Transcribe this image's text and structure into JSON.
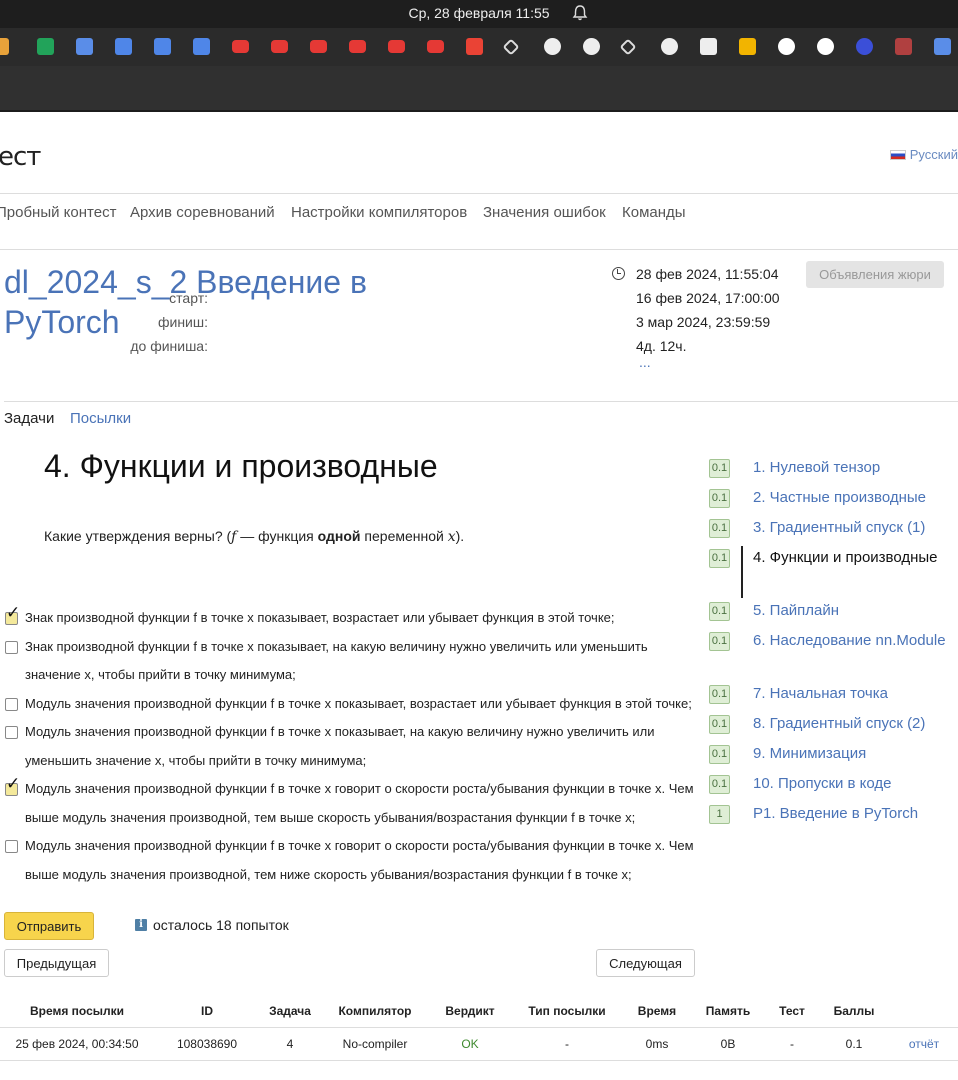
{
  "system": {
    "clock": "Ср, 28 февраля  11:55"
  },
  "bookmarks": [
    {
      "icon": "infinity-icon",
      "color": "#e8a23a"
    },
    {
      "icon": "sheets-icon",
      "color": "#22a35a"
    },
    {
      "icon": "swoosh-icon",
      "color": "#5a8de8"
    },
    {
      "icon": "cube-icon",
      "color": "#4f86e8"
    },
    {
      "icon": "cube-icon",
      "color": "#4f86e8"
    },
    {
      "icon": "cube-icon",
      "color": "#4f86e8"
    },
    {
      "icon": "youtube-icon",
      "color": "#e53935"
    },
    {
      "icon": "youtube-icon",
      "color": "#e53935"
    },
    {
      "icon": "youtube-icon",
      "color": "#e53935"
    },
    {
      "icon": "youtube-icon",
      "color": "#e53935"
    },
    {
      "icon": "youtube-icon",
      "color": "#e53935"
    },
    {
      "icon": "youtube-icon",
      "color": "#e53935"
    },
    {
      "icon": "gmail-icon",
      "color": "#ea4335"
    },
    {
      "icon": "link-icon",
      "color": "#dddddd"
    },
    {
      "icon": "github-icon",
      "color": "#eeeeee"
    },
    {
      "icon": "github-icon",
      "color": "#eeeeee"
    },
    {
      "icon": "link-icon",
      "color": "#dddddd"
    },
    {
      "icon": "github-icon",
      "color": "#eeeeee"
    },
    {
      "icon": "speedometer-icon",
      "color": "#eeeeee"
    },
    {
      "icon": "mail-icon",
      "color": "#f2b400"
    },
    {
      "icon": "google-icon",
      "color": "#ffffff"
    },
    {
      "icon": "google-icon",
      "color": "#ffffff"
    },
    {
      "icon": "zoom-icon",
      "color": "#3b4fd8"
    },
    {
      "icon": "kremlin-icon",
      "color": "#b04040"
    },
    {
      "icon": "spiral-icon",
      "color": "#5a8de8"
    }
  ],
  "site": {
    "logo": "ест",
    "language": "Русский"
  },
  "nav": [
    "Пробный контест",
    "Архив соревнований",
    "Настройки компиляторов",
    "Значения ошибок",
    "Команды"
  ],
  "contest": {
    "title": "dl_2024_s_2 Введение в PyTorch",
    "now": "28 фев 2024, 11:55:04",
    "start_label": "старт:",
    "start": "16 фев 2024, 17:00:00",
    "finish_label": "финиш:",
    "finish": "3 мар 2024, 23:59:59",
    "left_label": "до финиша:",
    "left": "4д. 12ч.",
    "more": "...",
    "jury_button": "Объявления жюри"
  },
  "tabs": {
    "problems": "Задачи",
    "submissions": "Посылки"
  },
  "problem": {
    "title": "4. Функции и производные",
    "question_pre": "Какие утверждения верны? (",
    "question_f": "f",
    "question_mid": " — функция ",
    "question_bold": "одной",
    "question_post1": " переменной ",
    "question_x": "x",
    "question_post2": ").",
    "options": [
      {
        "text": "Знак производной функции f в точке x показывает, возрастает или убывает функция в этой точке;",
        "checked": true
      },
      {
        "text": "Знак производной функции f в точке x показывает, на какую величину нужно увеличить или уменьшить значение x, чтобы прийти в точку минимума;",
        "checked": false
      },
      {
        "text": "Модуль значения производной функции f в точке x показывает, возрастает или убывает функция в этой точке;",
        "checked": false
      },
      {
        "text": "Модуль значения производной функции f в точке x показывает, на какую величину нужно увеличить или уменьшить значение x, чтобы прийти в точку минимума;",
        "checked": false
      },
      {
        "text": "Модуль значения производной функции f в точке x говорит о скорости роста/убывания функции в точке x. Чем выше модуль значения производной, тем выше скорость убывания/возрастания функции f в точке x;",
        "checked": true
      },
      {
        "text": "Модуль значения производной функции f в точке x говорит о скорости роста/убывания функции в точке x. Чем выше модуль значения производной, тем ниже скорость убывания/возрастания функции f в точке x;",
        "checked": false
      }
    ],
    "submit": "Отправить",
    "attempts": "осталось 18 попыток",
    "prev": "Предыдущая",
    "next": "Следующая"
  },
  "problem_list": [
    {
      "score": "0.1",
      "name": "1. Нулевой тензор"
    },
    {
      "score": "0.1",
      "name": "2. Частные производные"
    },
    {
      "score": "0.1",
      "name": "3. Градиентный спуск (1)"
    },
    {
      "score": "0.1",
      "name": "4. Функции и производные",
      "current": true
    },
    {
      "score": "0.1",
      "name": "5. Пайплайн"
    },
    {
      "score": "0.1",
      "name": "6. Наследование nn.Module"
    },
    {
      "score": "0.1",
      "name": "7. Начальная точка"
    },
    {
      "score": "0.1",
      "name": "8. Градиентный спуск (2)"
    },
    {
      "score": "0.1",
      "name": "9. Минимизация"
    },
    {
      "score": "0.1",
      "name": "10. Пропуски в коде"
    },
    {
      "score": "1",
      "name": "P1. Введение в PyTorch"
    }
  ],
  "submissions": {
    "headers": [
      "Время посылки",
      "ID",
      "Задача",
      "Компилятор",
      "Вердикт",
      "Тип посылки",
      "Время",
      "Память",
      "Тест",
      "Баллы",
      ""
    ],
    "rows": [
      [
        "25 фев 2024, 00:34:50",
        "108038690",
        "4",
        "No-compiler",
        "OK",
        "-",
        "0ms",
        "0B",
        "-",
        "0.1",
        "отчёт"
      ]
    ]
  }
}
